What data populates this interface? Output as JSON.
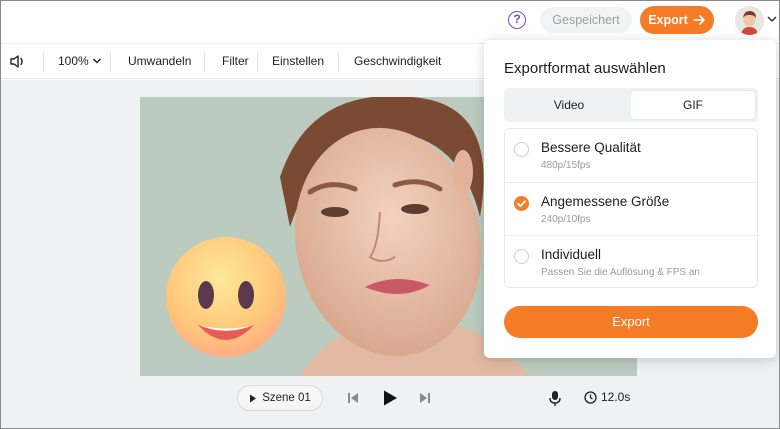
{
  "topbar": {
    "help_icon": "question-circle-icon",
    "saved_label": "Gespeichert",
    "export_label": "Export"
  },
  "toolbar": {
    "volume_icon": "volume-icon",
    "zoom": "100%",
    "items": [
      "Umwandeln",
      "Filter",
      "Einstellen",
      "Geschwindigkeit"
    ]
  },
  "player": {
    "scene_label": "Szene 01",
    "duration": "12.0s"
  },
  "export_panel": {
    "title": "Exportformat auswählen",
    "tabs": [
      {
        "label": "Video",
        "active": false
      },
      {
        "label": "GIF",
        "active": true
      }
    ],
    "options": [
      {
        "title": "Bessere Qualität",
        "subtitle": "480p/15fps",
        "selected": false
      },
      {
        "title": "Angemessene Größe",
        "subtitle": "240p/10fps",
        "selected": true
      },
      {
        "title": "Individuell",
        "subtitle": "Passen Sie die Auflösung & FPS an",
        "selected": false
      }
    ],
    "export_button": "Export"
  },
  "colors": {
    "accent": "#f47c26",
    "help": "#6a4fd1"
  }
}
